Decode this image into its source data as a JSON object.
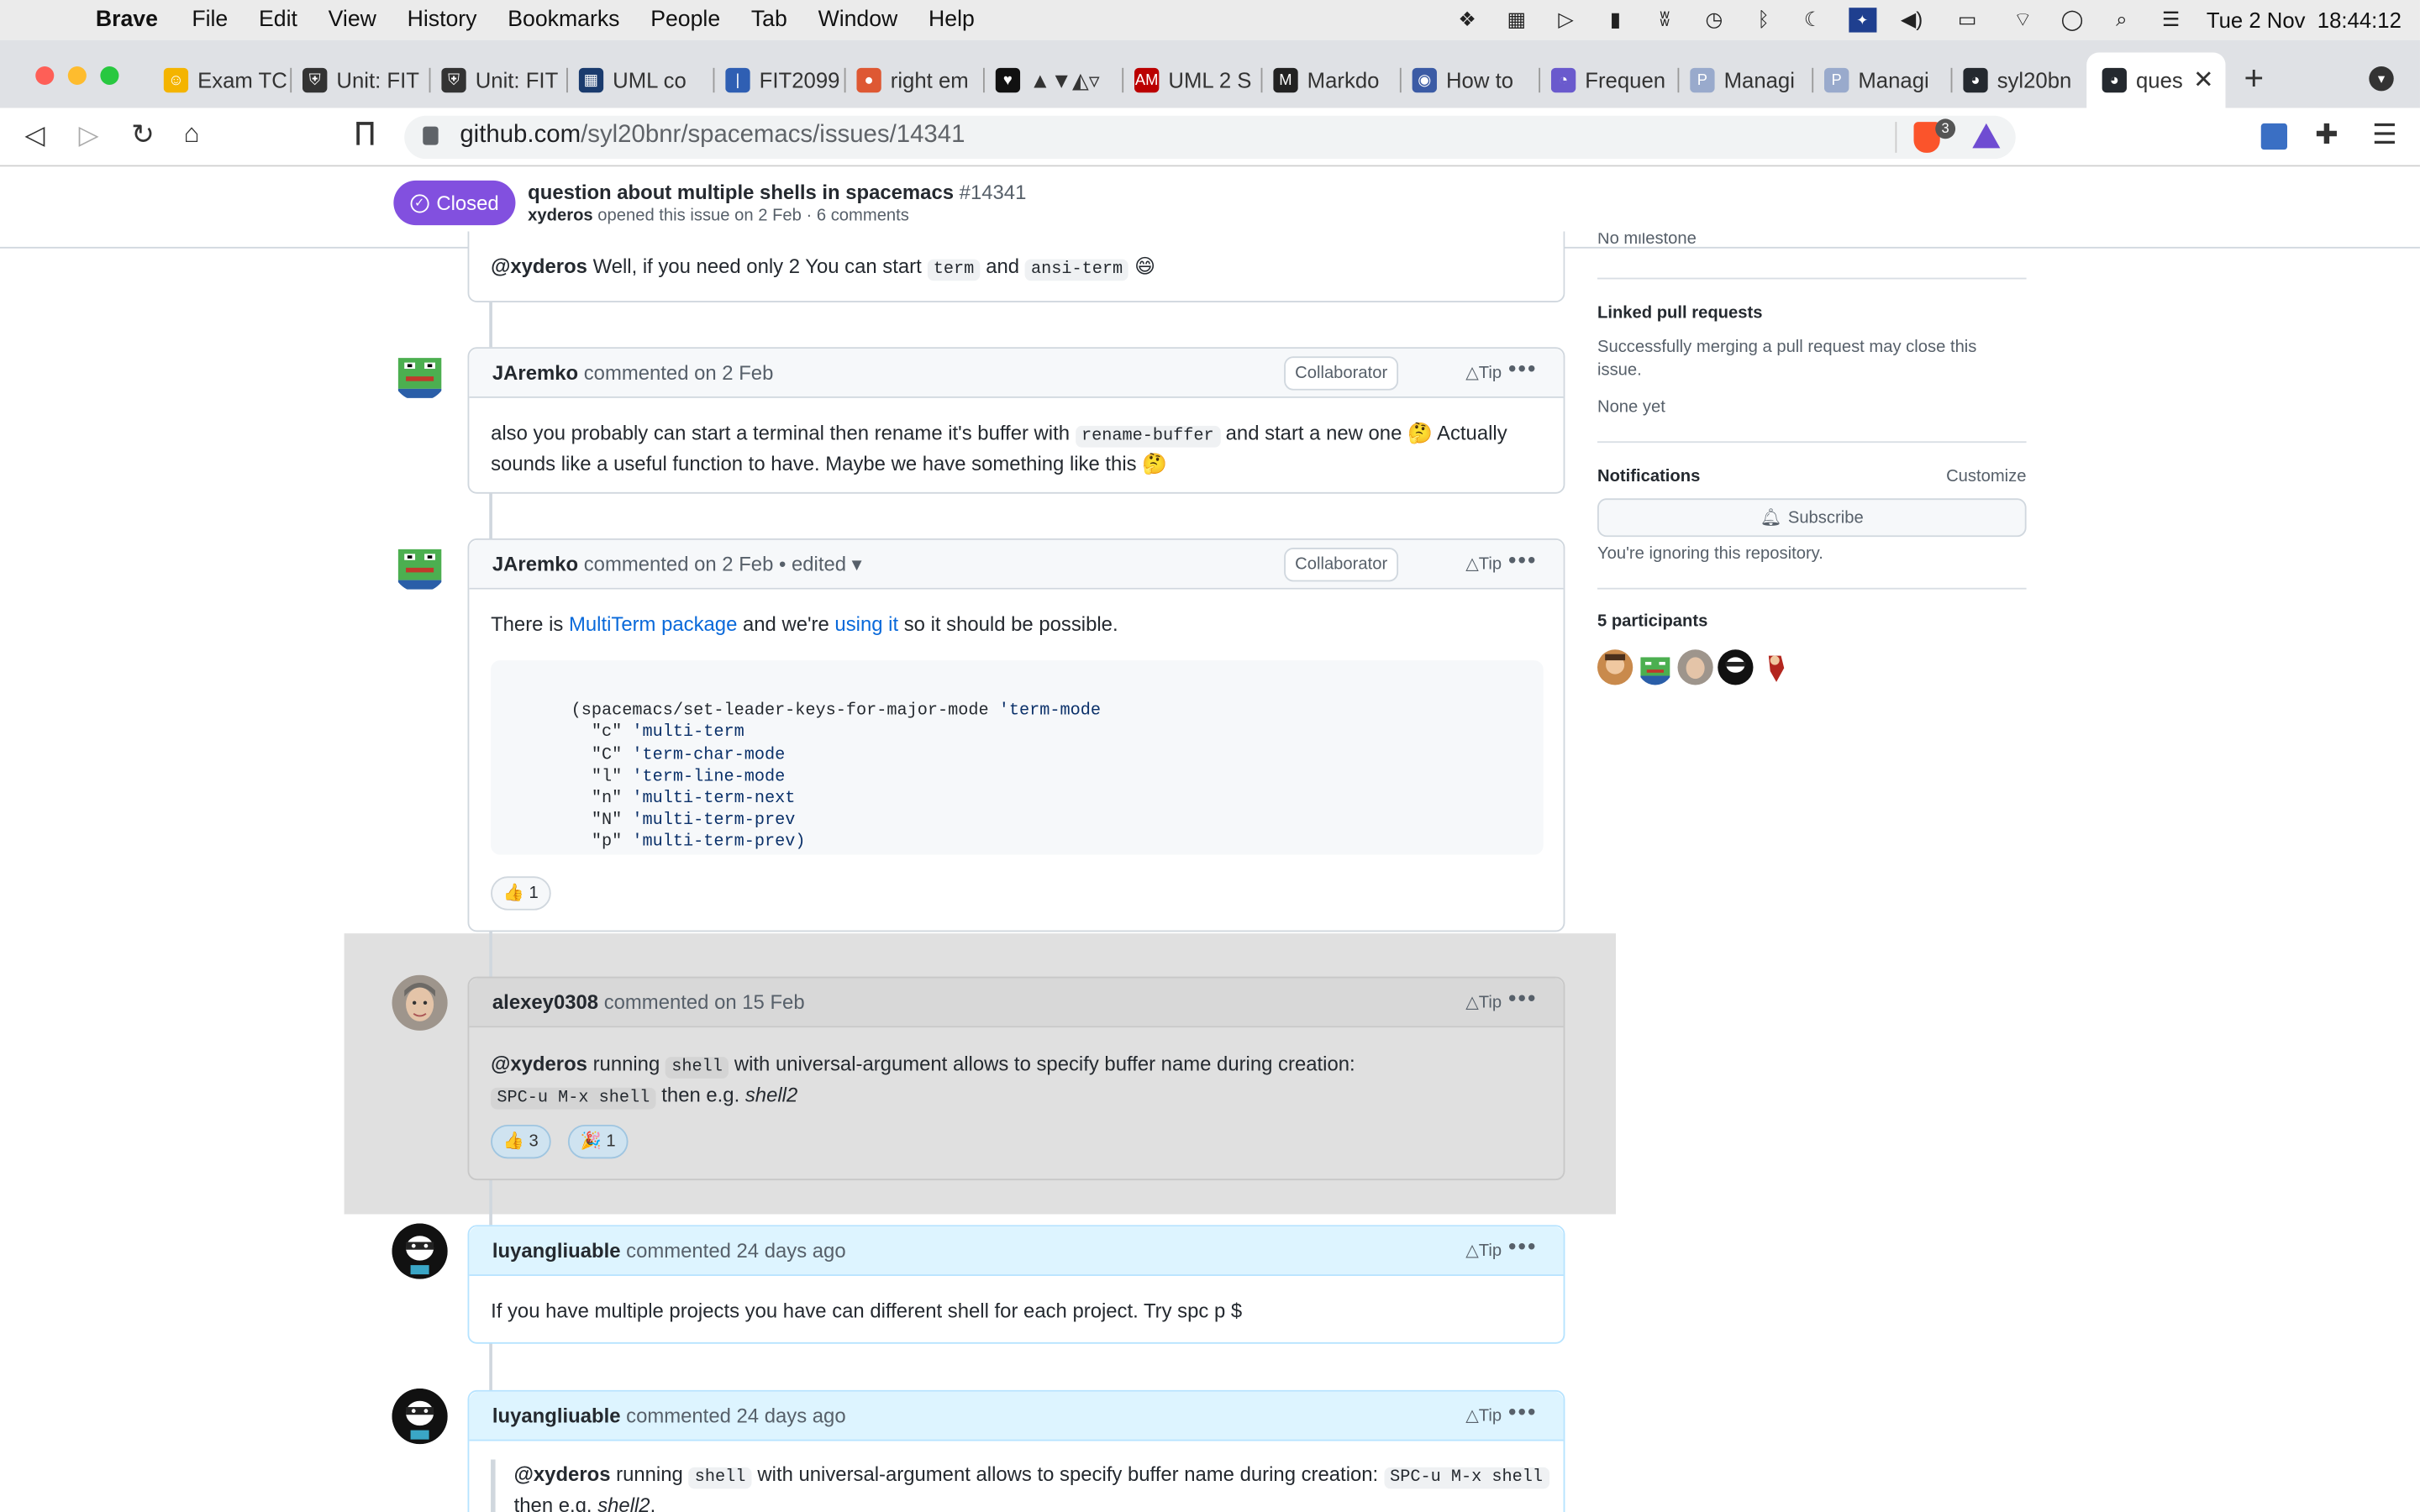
{
  "menubar": {
    "app": "Brave",
    "items": [
      "File",
      "Edit",
      "View",
      "History",
      "Bookmarks",
      "People",
      "Tab",
      "Window",
      "Help"
    ],
    "clock": "Tue 2 Nov  18:44:12"
  },
  "tabs": [
    {
      "label": "Exam TC",
      "color": "#f4b400",
      "glyph": "☺"
    },
    {
      "label": "Unit: FIT",
      "color": "#333",
      "glyph": "⛨"
    },
    {
      "label": "Unit: FIT",
      "color": "#333",
      "glyph": "⛨"
    },
    {
      "label": "UML co",
      "color": "#1a3b6e",
      "glyph": "▦"
    },
    {
      "label": "FIT2099",
      "color": "#2f5fb3",
      "glyph": "|"
    },
    {
      "label": "right em",
      "color": "#de5833",
      "glyph": "●"
    },
    {
      "label": "▲▼◭▿",
      "color": "#111",
      "glyph": "♥"
    },
    {
      "label": "UML 2 S",
      "color": "#b00",
      "glyph": "AM"
    },
    {
      "label": "Markdo",
      "color": "#222",
      "glyph": "M"
    },
    {
      "label": "How to",
      "color": "#3b5ba5",
      "glyph": "◉"
    },
    {
      "label": "Frequen",
      "color": "#6a5acd",
      "glyph": "◔"
    },
    {
      "label": "Managi",
      "color": "#9ac",
      "glyph": "P"
    },
    {
      "label": "Managi",
      "color": "#9ac",
      "glyph": "P"
    },
    {
      "label": "syl20bn",
      "color": "#24292f",
      "glyph": "◕"
    },
    {
      "label": "ques",
      "color": "#24292f",
      "glyph": "◕"
    }
  ],
  "address": {
    "host": "github.com",
    "path": "/syl20bnr/spacemacs/issues/14341",
    "shield_count": "3"
  },
  "issue": {
    "state": "Closed",
    "title": "question about multiple shells in spacemacs",
    "number": "#14341",
    "author": "xyderos",
    "subtitle": " opened this issue on 2 Feb · 6 comments"
  },
  "top_partial": {
    "mention": "@xyderos",
    "text1": " Well, if you need only 2 You can start ",
    "code1": "term",
    "text2": " and ",
    "code2": "ansi-term",
    "emoji": " 😄"
  },
  "comments": [
    {
      "author": "JAremko",
      "meta": " commented on 2 Feb",
      "badge": "Collaborator",
      "tip": "Tip",
      "line1a": "also you probably can start a terminal then rename it's buffer with ",
      "line1code": "rename-buffer",
      "line1b": " and start a new one 🤔 Actually",
      "line2": "sounds like a useful function to have. Maybe we have something like this 🤔"
    },
    {
      "author": "JAremko",
      "meta": " commented on 2 Feb • edited ▾",
      "badge": "Collaborator",
      "tip": "Tip",
      "p1": "There is ",
      "link1": "MultiTerm package",
      "p2": " and we're ",
      "link2": "using it",
      "p3": " so it should be possible.",
      "code_lines": [
        {
          "a": "(spacemacs/set-leader-keys-for-major-mode ",
          "b": "'term-mode"
        },
        {
          "a": "  \"c\" ",
          "b": "'multi-term"
        },
        {
          "a": "  \"C\" ",
          "b": "'term-char-mode"
        },
        {
          "a": "  \"l\" ",
          "b": "'term-line-mode"
        },
        {
          "a": "  \"n\" ",
          "b": "'multi-term-next"
        },
        {
          "a": "  \"N\" ",
          "b": "'multi-term-prev"
        },
        {
          "a": "  \"p\" ",
          "b": "'multi-term-prev)"
        }
      ],
      "reaction": "👍 1"
    },
    {
      "author": "alexey0308",
      "meta": " commented on 15 Feb",
      "tip": "Tip",
      "mention": "@xyderos",
      "t1": " running ",
      "c1": "shell",
      "t2": " with universal-argument allows to specify buffer name during creation:",
      "c2": "SPC-u M-x shell",
      "t3": " then e.g. ",
      "em": "shell2",
      ".": ".",
      "reaction1": "👍 3",
      "reaction2": "🎉 1"
    },
    {
      "author": "luyangliuable",
      "meta": " commented 24 days ago",
      "tip": "Tip",
      "text": "If you have multiple projects you have can different shell for each project. Try spc p $"
    },
    {
      "author": "luyangliuable",
      "meta": " commented 24 days ago",
      "tip": "Tip",
      "mention": "@xyderos",
      "t1": " running ",
      "c1": "shell",
      "t2": " with universal-argument allows to specify buffer name during creation: ",
      "c2": "SPC-u M-x shell",
      "t3": "then e.g. ",
      "em": "shell2"
    }
  ],
  "sidebar": {
    "milestone_cut": "No milestone",
    "linked_title": "Linked pull requests",
    "linked_text": "Successfully merging a pull request may close this issue.",
    "linked_none": "None yet",
    "notif_title": "Notifications",
    "customize": "Customize",
    "subscribe": "Subscribe",
    "ignoring": "You're ignoring this repository.",
    "participants": "5 participants"
  }
}
